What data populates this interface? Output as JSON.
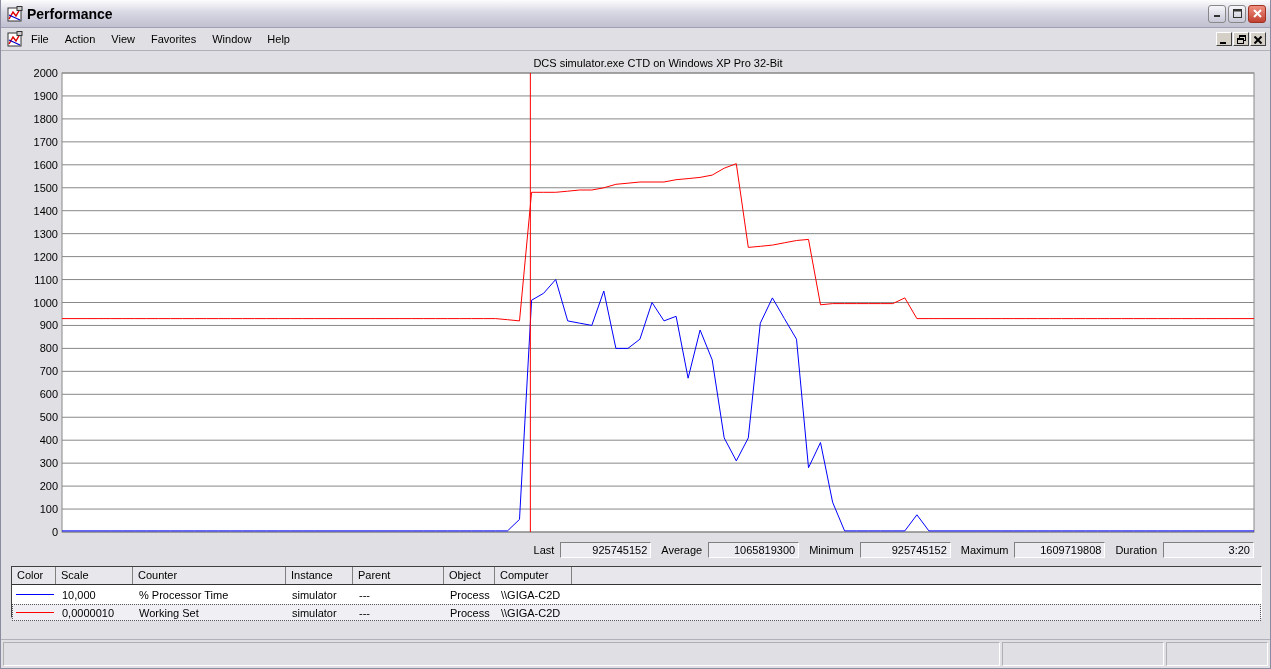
{
  "window": {
    "title": "Performance"
  },
  "menu": [
    {
      "label": "File"
    },
    {
      "label": "Action"
    },
    {
      "label": "View"
    },
    {
      "label": "Favorites"
    },
    {
      "label": "Window"
    },
    {
      "label": "Help"
    }
  ],
  "chart": {
    "chart_data": {
      "type": "line",
      "grid": true,
      "title": "DCS simulator.exe CTD on Windows XP Pro 32-Bit",
      "ylim": [
        0,
        2000
      ],
      "yticks": [
        0,
        100,
        200,
        300,
        400,
        500,
        600,
        700,
        800,
        900,
        1000,
        1100,
        1200,
        1300,
        1400,
        1500,
        1600,
        1700,
        1800,
        1900,
        2000
      ],
      "series": [
        {
          "color": "#0000ff",
          "values": [
            5,
            5,
            5,
            5,
            5,
            5,
            5,
            5,
            5,
            5,
            5,
            5,
            5,
            5,
            5,
            5,
            5,
            5,
            5,
            5,
            5,
            5,
            5,
            5,
            5,
            5,
            5,
            5,
            5,
            5,
            5,
            5,
            5,
            5,
            5,
            5,
            5,
            5,
            55,
            1010,
            1040,
            1100,
            920,
            910,
            900,
            1050,
            800,
            800,
            840,
            1000,
            920,
            940,
            670,
            880,
            750,
            410,
            310,
            410,
            910,
            1020,
            930,
            840,
            280,
            390,
            130,
            5,
            5,
            5,
            5,
            5,
            5,
            75,
            5,
            5,
            5,
            5,
            5,
            5,
            5,
            5,
            5,
            5,
            5,
            5,
            5,
            5,
            5,
            5,
            5,
            5,
            5,
            5,
            5,
            5,
            5,
            5,
            5,
            5,
            5,
            5
          ]
        },
        {
          "color": "#ff0000",
          "values": [
            930,
            930,
            930,
            930,
            930,
            930,
            930,
            930,
            930,
            930,
            930,
            930,
            930,
            930,
            930,
            930,
            930,
            930,
            930,
            930,
            930,
            930,
            930,
            930,
            930,
            930,
            930,
            930,
            930,
            930,
            930,
            930,
            930,
            930,
            930,
            930,
            930,
            925,
            920,
            1480,
            1480,
            1480,
            1485,
            1490,
            1490,
            1500,
            1515,
            1520,
            1525,
            1525,
            1525,
            1535,
            1540,
            1545,
            1555,
            1585,
            1605,
            1240,
            1245,
            1250,
            1260,
            1270,
            1275,
            990,
            995,
            995,
            995,
            995,
            995,
            995,
            1020,
            930,
            930,
            930,
            930,
            930,
            930,
            930,
            930,
            930,
            930,
            930,
            930,
            930,
            930,
            930,
            930,
            930,
            930,
            930,
            930,
            930,
            930,
            930,
            930,
            930,
            930,
            930,
            930,
            930
          ]
        }
      ]
    }
  },
  "stats": [
    {
      "label": "Last",
      "value": "925745152"
    },
    {
      "label": "Average",
      "value": "1065819300"
    },
    {
      "label": "Minimum",
      "value": "925745152"
    },
    {
      "label": "Maximum",
      "value": "1609719808"
    },
    {
      "label": "Duration",
      "value": "3:20"
    }
  ],
  "table": {
    "columns": [
      "Color",
      "Scale",
      "Counter",
      "Instance",
      "Parent",
      "Object",
      "Computer"
    ],
    "rows": [
      {
        "color": "#0000ff",
        "scale": "10,000",
        "counter": "% Processor Time",
        "instance": "simulator",
        "parent": "---",
        "object": "Process",
        "computer": "\\\\GIGA-C2D",
        "selected": false
      },
      {
        "color": "#ff0000",
        "scale": "0,0000010",
        "counter": "Working Set",
        "instance": "simulator",
        "parent": "---",
        "object": "Process",
        "computer": "\\\\GIGA-C2D",
        "selected": true
      }
    ]
  }
}
